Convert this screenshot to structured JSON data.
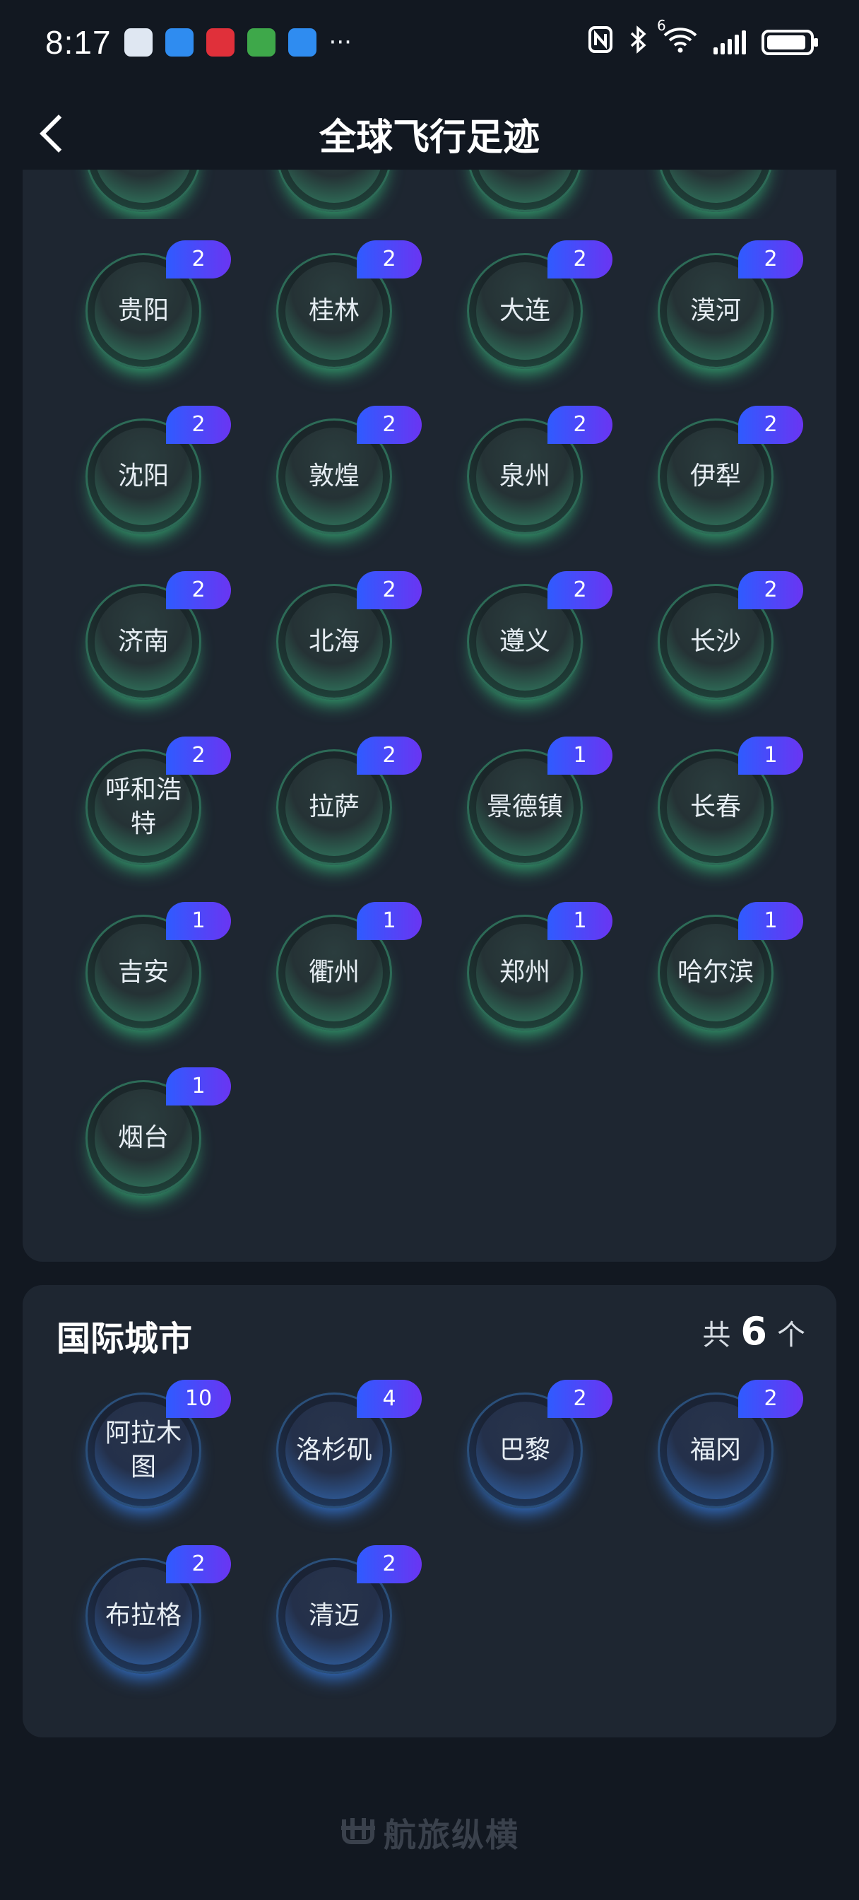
{
  "status_bar": {
    "time": "8:17",
    "more": "···",
    "network": "6"
  },
  "header": {
    "title": "全球飞行足迹"
  },
  "domestic": {
    "cities": [
      {
        "name": "贵阳",
        "count": "2"
      },
      {
        "name": "桂林",
        "count": "2"
      },
      {
        "name": "大连",
        "count": "2"
      },
      {
        "name": "漠河",
        "count": "2"
      },
      {
        "name": "沈阳",
        "count": "2"
      },
      {
        "name": "敦煌",
        "count": "2"
      },
      {
        "name": "泉州",
        "count": "2"
      },
      {
        "name": "伊犁",
        "count": "2"
      },
      {
        "name": "济南",
        "count": "2"
      },
      {
        "name": "北海",
        "count": "2"
      },
      {
        "name": "遵义",
        "count": "2"
      },
      {
        "name": "长沙",
        "count": "2"
      },
      {
        "name": "呼和浩特",
        "count": "2"
      },
      {
        "name": "拉萨",
        "count": "2"
      },
      {
        "name": "景德镇",
        "count": "1"
      },
      {
        "name": "长春",
        "count": "1"
      },
      {
        "name": "吉安",
        "count": "1"
      },
      {
        "name": "衢州",
        "count": "1"
      },
      {
        "name": "郑州",
        "count": "1"
      },
      {
        "name": "哈尔滨",
        "count": "1"
      },
      {
        "name": "烟台",
        "count": "1"
      }
    ]
  },
  "international": {
    "title": "国际城市",
    "count_prefix": "共",
    "count": "6",
    "count_suffix": "个",
    "cities": [
      {
        "name": "阿拉木图",
        "count": "10"
      },
      {
        "name": "洛杉矶",
        "count": "4"
      },
      {
        "name": "巴黎",
        "count": "2"
      },
      {
        "name": "福冈",
        "count": "2"
      },
      {
        "name": "布拉格",
        "count": "2"
      },
      {
        "name": "清迈",
        "count": "2"
      }
    ]
  },
  "footer": {
    "brand": "航旅纵横"
  },
  "colors": {
    "badge_start": "#2f5bff",
    "badge_end": "#6a35f2",
    "domestic_glow": "#49d48f",
    "international_glow": "#3d8af0"
  }
}
